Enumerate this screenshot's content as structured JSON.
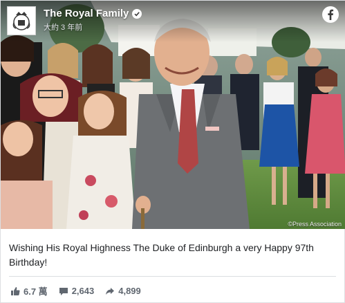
{
  "post": {
    "page_name": "The Royal Family",
    "timestamp": "大約 3 年前",
    "photo_credit": "©Press Association",
    "message": "Wishing His Royal Highness The Duke of Edinburgh a very Happy 97th Birthday!",
    "stats": {
      "likes": "6.7 萬",
      "comments": "2,643",
      "shares": "4,899"
    }
  },
  "colors": {
    "facebook_blue": "#ffffff",
    "stat_gray": "#606770",
    "verified_bg": "#ffffff"
  },
  "icons": {
    "avatar": "royal-crest-icon",
    "verified": "verified-badge-icon",
    "brand": "facebook-icon",
    "likes": "thumbs-up-icon",
    "comments": "comment-icon",
    "shares": "share-arrow-icon"
  }
}
